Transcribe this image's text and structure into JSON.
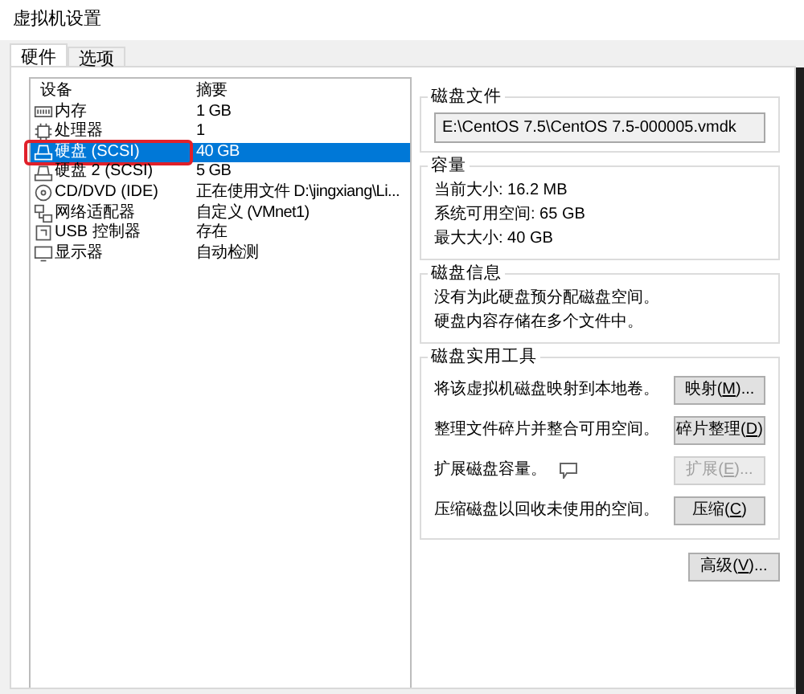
{
  "window": {
    "title": "虚拟机设置"
  },
  "tabs": [
    {
      "label": "硬件",
      "selected": true
    },
    {
      "label": "选项",
      "selected": false
    }
  ],
  "device_list": {
    "columns": [
      "设备",
      "摘要"
    ],
    "rows": [
      {
        "kind": "memory",
        "device": "内存",
        "summary": "1 GB",
        "selected": false,
        "highlighted": false
      },
      {
        "kind": "cpu",
        "device": "处理器",
        "summary": "1",
        "selected": false,
        "highlighted": false
      },
      {
        "kind": "disk",
        "device": "硬盘 (SCSI)",
        "summary": "40 GB",
        "selected": true,
        "highlighted": true
      },
      {
        "kind": "disk",
        "device": "硬盘 2 (SCSI)",
        "summary": "5 GB",
        "selected": false,
        "highlighted": false
      },
      {
        "kind": "cdrom",
        "device": "CD/DVD (IDE)",
        "summary": "正在使用文件 D:\\jingxiang\\Li...",
        "selected": false,
        "highlighted": false
      },
      {
        "kind": "network",
        "device": "网络适配器",
        "summary": "自定义 (VMnet1)",
        "selected": false,
        "highlighted": false
      },
      {
        "kind": "usb",
        "device": "USB 控制器",
        "summary": "存在",
        "selected": false,
        "highlighted": false
      },
      {
        "kind": "display",
        "device": "显示器",
        "summary": "自动检测",
        "selected": false,
        "highlighted": false
      }
    ]
  },
  "disk_file": {
    "title": "磁盘文件",
    "value": "E:\\CentOS 7.5\\CentOS 7.5-000005.vmdk"
  },
  "capacity": {
    "title": "容量",
    "lines": [
      "当前大小: 16.2 MB",
      "系统可用空间: 65 GB",
      "最大大小: 40 GB"
    ]
  },
  "disk_info": {
    "title": "磁盘信息",
    "lines": [
      "没有为此硬盘预分配磁盘空间。",
      "硬盘内容存储在多个文件中。"
    ]
  },
  "disk_utilities": {
    "title": "磁盘实用工具",
    "rows": [
      {
        "text": "将该虚拟机磁盘映射到本地卷。",
        "button": "映射(**M**)...",
        "disabled": false,
        "info_icon": false
      },
      {
        "text": "整理文件碎片并整合可用空间。",
        "button": "碎片整理(**D**)",
        "disabled": false,
        "info_icon": false
      },
      {
        "text": "扩展磁盘容量。",
        "button": "扩展(**E**)...",
        "disabled": true,
        "info_icon": true
      },
      {
        "text": "压缩磁盘以回收未使用的空间。",
        "button": "压缩(**C**)",
        "disabled": false,
        "info_icon": false
      }
    ]
  },
  "advanced_button": "高级(**V**)..."
}
